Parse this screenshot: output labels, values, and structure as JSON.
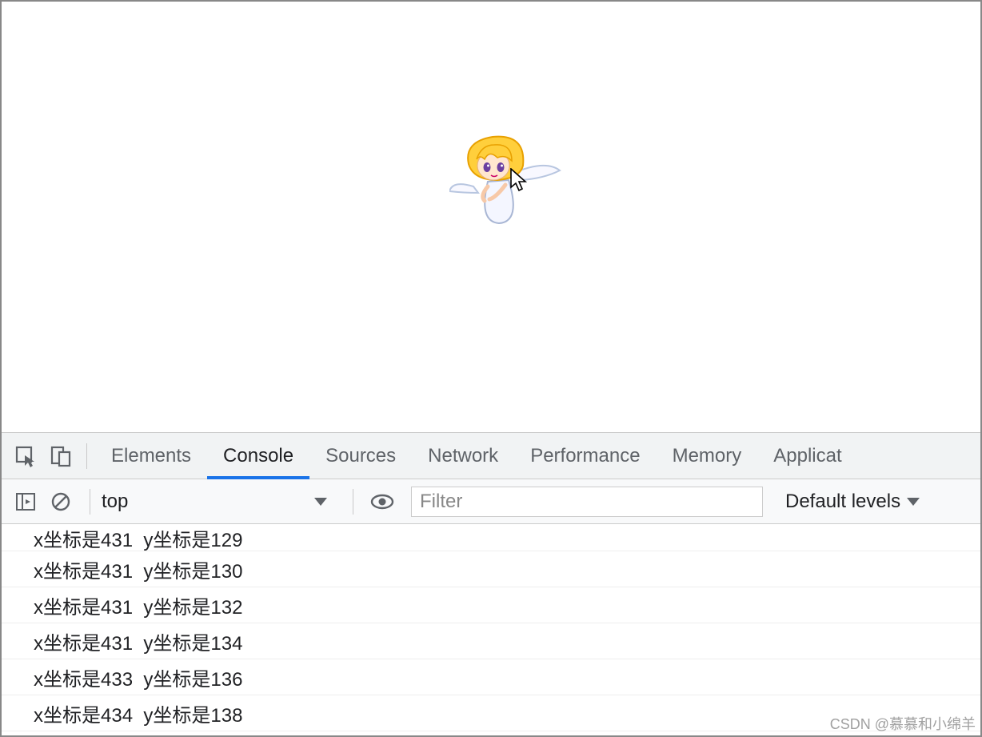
{
  "viewport": {
    "sprite_name": "angel-sprite",
    "cursor_name": "cursor-icon"
  },
  "devtools": {
    "tabs": [
      {
        "label": "Elements",
        "active": false
      },
      {
        "label": "Console",
        "active": true
      },
      {
        "label": "Sources",
        "active": false
      },
      {
        "label": "Network",
        "active": false
      },
      {
        "label": "Performance",
        "active": false
      },
      {
        "label": "Memory",
        "active": false
      },
      {
        "label": "Applicat",
        "active": false
      }
    ],
    "toolbar": {
      "context": "top",
      "filter_placeholder": "Filter",
      "level": "Default levels"
    },
    "logs": [
      {
        "text": "x坐标是431  y坐标是129",
        "partial": true
      },
      {
        "text": "x坐标是431  y坐标是130",
        "partial": false
      },
      {
        "text": "x坐标是431  y坐标是132",
        "partial": false
      },
      {
        "text": "x坐标是431  y坐标是134",
        "partial": false
      },
      {
        "text": "x坐标是433  y坐标是136",
        "partial": false
      },
      {
        "text": "x坐标是434  y坐标是138",
        "partial": false
      }
    ]
  },
  "watermark": "CSDN @慕慕和小绵羊"
}
